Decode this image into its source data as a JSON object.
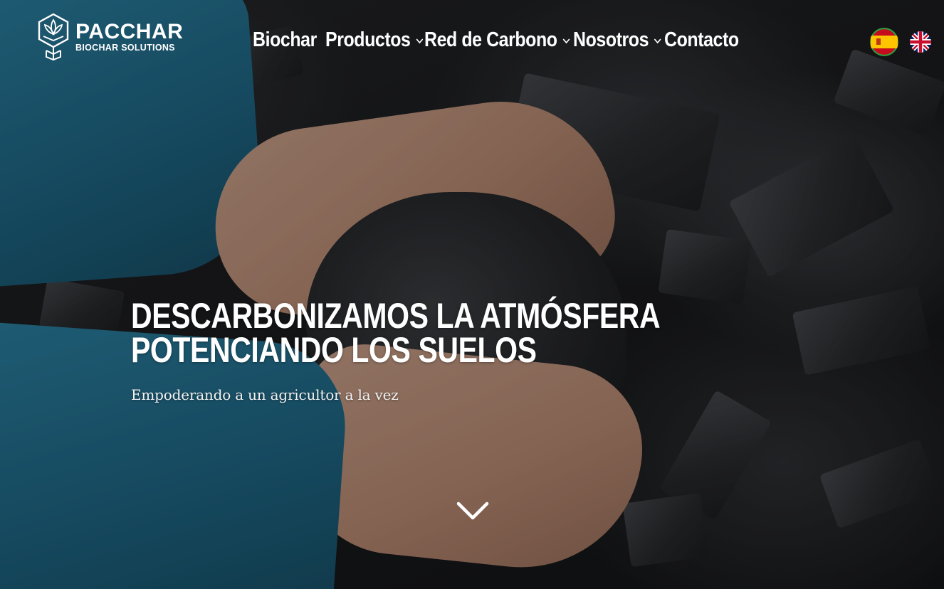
{
  "brand": {
    "name": "PACCHAR",
    "tagline": "BIOCHAR SOLUTIONS",
    "logo_icon": "lotus-hexagon-icon"
  },
  "nav": {
    "items": [
      {
        "label": "Biochar",
        "has_dropdown": false
      },
      {
        "label": "Productos",
        "has_dropdown": true
      },
      {
        "label": "Red de Carbono",
        "has_dropdown": true
      },
      {
        "label": "Nosotros",
        "has_dropdown": true
      },
      {
        "label": "Contacto",
        "has_dropdown": false
      }
    ]
  },
  "languages": [
    {
      "code": "es",
      "icon": "spain-flag-icon",
      "active": true
    },
    {
      "code": "en",
      "icon": "uk-flag-icon",
      "active": false
    }
  ],
  "hero": {
    "headline_line1": "DESCARBONIZAMOS LA ATMÓSFERA",
    "headline_line2": "POTENCIANDO LOS SUELOS",
    "subheadline": "Empoderando a un agricultor a la vez",
    "scroll_icon": "chevron-down-icon"
  },
  "colors": {
    "text": "#ffffff",
    "sleeve": "#1f6684",
    "background": "#1b1c1e"
  }
}
